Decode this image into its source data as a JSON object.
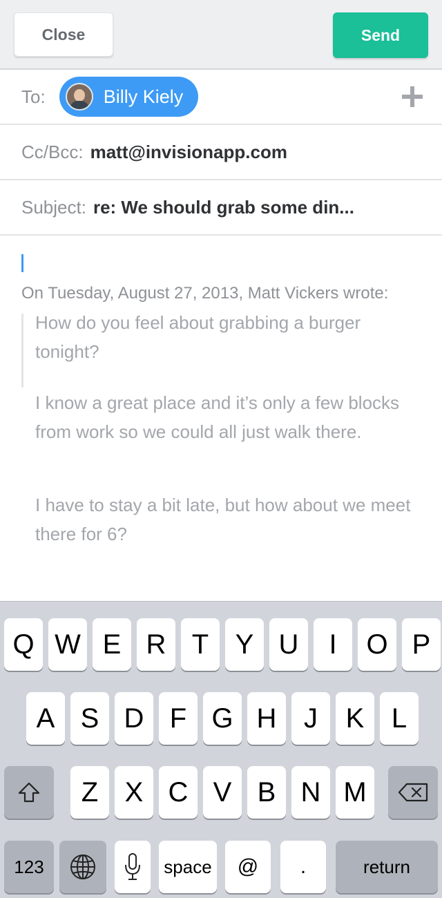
{
  "toolbar": {
    "close_label": "Close",
    "send_label": "Send"
  },
  "to": {
    "label": "To:",
    "recipient": "Billy Kiely"
  },
  "cc": {
    "label": "Cc/Bcc:",
    "value": "matt@invisionapp.com"
  },
  "subject": {
    "label": "Subject:",
    "value": "re: We should grab some din..."
  },
  "body": {
    "quote_header": "On Tuesday, August 27, 2013, Matt Vickers wrote:",
    "paragraphs": [
      "How do you feel about grabbing a burger tonight?",
      "I know a great place and it’s only a few blocks from work so we could all just walk there.",
      "I have to stay a bit late, but how about we meet there for 6?"
    ]
  },
  "keyboard": {
    "row1": [
      "Q",
      "W",
      "E",
      "R",
      "T",
      "Y",
      "U",
      "I",
      "O",
      "P"
    ],
    "row2": [
      "A",
      "S",
      "D",
      "F",
      "G",
      "H",
      "J",
      "K",
      "L"
    ],
    "row3": [
      "Z",
      "X",
      "C",
      "V",
      "B",
      "N",
      "M"
    ],
    "numbers_label": "123",
    "space_label": "space",
    "at_label": "@",
    "period_label": ".",
    "return_label": "return",
    "icons": {
      "shift": "shift-icon",
      "backspace": "backspace-icon",
      "globe": "globe-icon",
      "mic": "microphone-icon"
    }
  },
  "colors": {
    "send": "#1bbf98",
    "chip": "#3d9bf5",
    "cursor": "#3d9bf5",
    "keyboard_bg": "#d1d5db",
    "dark_key": "#aeb3bb"
  }
}
